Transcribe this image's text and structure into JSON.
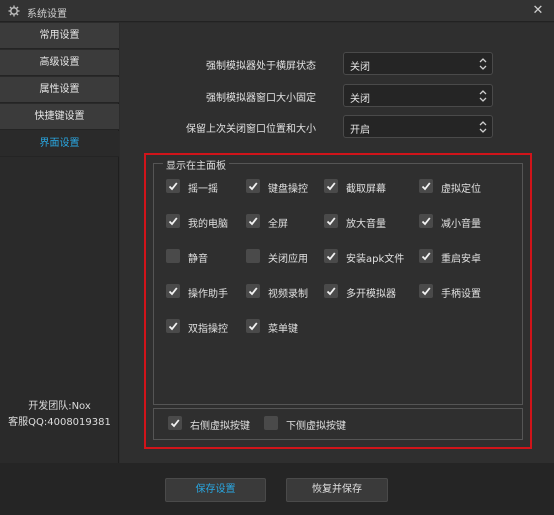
{
  "window": {
    "title": "系统设置",
    "close": "✕"
  },
  "sidebar": {
    "items": [
      {
        "label": "常用设置",
        "active": false
      },
      {
        "label": "高级设置",
        "active": false
      },
      {
        "label": "属性设置",
        "active": false
      },
      {
        "label": "快捷键设置",
        "active": false
      },
      {
        "label": "界面设置",
        "active": true
      }
    ],
    "team": "开发团队:Nox",
    "qq": "客服QQ:4008019381"
  },
  "settings": [
    {
      "label": "强制模拟器处于横屏状态",
      "value": "关闭"
    },
    {
      "label": "强制模拟器窗口大小固定",
      "value": "关闭"
    },
    {
      "label": "保留上次关闭窗口位置和大小",
      "value": "开启"
    }
  ],
  "panel": {
    "title": "显示在主面板",
    "checkboxes": [
      {
        "label": "摇一摇",
        "checked": true
      },
      {
        "label": "键盘操控",
        "checked": true
      },
      {
        "label": "截取屏幕",
        "checked": true
      },
      {
        "label": "虚拟定位",
        "checked": true
      },
      {
        "label": "我的电脑",
        "checked": true
      },
      {
        "label": "全屏",
        "checked": true
      },
      {
        "label": "放大音量",
        "checked": true
      },
      {
        "label": "减小音量",
        "checked": true
      },
      {
        "label": "静音",
        "checked": false
      },
      {
        "label": "关闭应用",
        "checked": false
      },
      {
        "label": "安装apk文件",
        "checked": true
      },
      {
        "label": "重启安卓",
        "checked": true
      },
      {
        "label": "操作助手",
        "checked": true
      },
      {
        "label": "视频录制",
        "checked": true
      },
      {
        "label": "多开模拟器",
        "checked": true
      },
      {
        "label": "手柄设置",
        "checked": true
      },
      {
        "label": "双指操控",
        "checked": true
      },
      {
        "label": "菜单键",
        "checked": true
      }
    ],
    "bottom": [
      {
        "label": "右侧虚拟按键",
        "checked": true
      },
      {
        "label": "下侧虚拟按键",
        "checked": false
      }
    ]
  },
  "footer": {
    "save_label": "保存设置",
    "restore_label": "恢复并保存"
  },
  "colors": {
    "accent": "#29a7e1",
    "highlight": "#d0141a"
  }
}
